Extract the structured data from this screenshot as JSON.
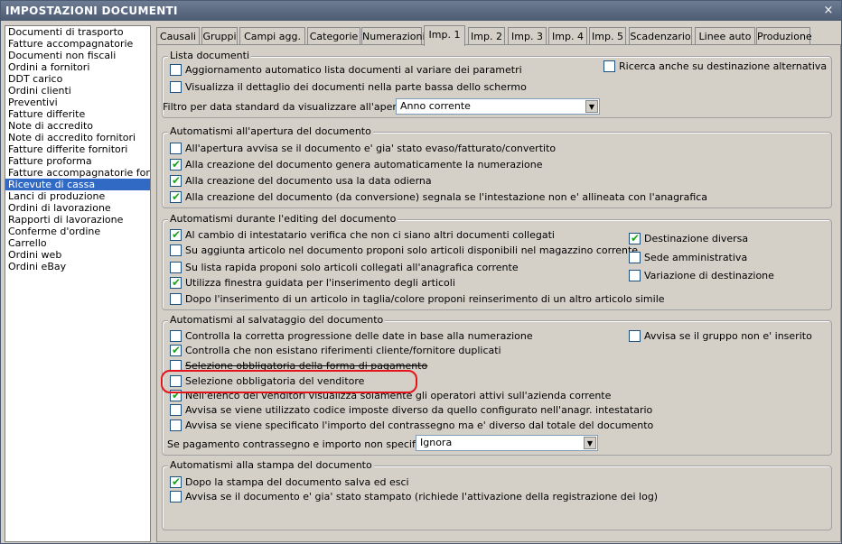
{
  "window": {
    "title": "IMPOSTAZIONI DOCUMENTI",
    "close_symbol": "×"
  },
  "doc_list": [
    "Documenti di trasporto",
    "Fatture accompagnatorie",
    "Documenti non fiscali",
    "Ordini a fornitori",
    "DDT carico",
    "Ordini clienti",
    "Preventivi",
    "Fatture differite",
    "Note di accredito",
    "Note di accredito fornitori",
    "Fatture differite fornitori",
    "Fatture proforma",
    "Fatture accompagnatorie fornito",
    "Ricevute di cassa",
    "Lanci di produzione",
    "Ordini di lavorazione",
    "Rapporti di lavorazione",
    "Conferme d'ordine",
    "Carrello",
    "Ordini web",
    "Ordini eBay"
  ],
  "doc_list_selected": "Ricevute di cassa",
  "tabs": [
    "Causali",
    "Gruppi",
    "Campi agg.",
    "Categorie",
    "Numerazioni",
    "Imp. 1",
    "Imp. 2",
    "Imp. 3",
    "Imp. 4",
    "Imp. 5",
    "Scadenzario",
    "Linee auto",
    "Produzione"
  ],
  "active_tab": "Imp. 1",
  "lista": {
    "label": "Lista documenti",
    "cb1": "Aggiornamento automatico lista documenti al variare dei parametri",
    "cb2": "Visualizza il dettaglio dei documenti nella parte bassa dello schermo",
    "cb3": "Ricerca anche su destinazione alternativa",
    "filtro_label": "Filtro per data standard da visualizzare all'apertura :",
    "filtro_value": "Anno corrente"
  },
  "apertura": {
    "label": "Automatismi all'apertura del documento",
    "cb1": "All'apertura avvisa se il documento e' gia' stato evaso/fatturato/convertito",
    "cb2": "Alla creazione del documento genera automaticamente la numerazione",
    "cb3": "Alla creazione del documento usa la data odierna",
    "cb4": "Alla creazione del documento (da conversione) segnala se l'intestazione non e' allineata con l'anagrafica"
  },
  "editing": {
    "label": "Automatismi durante l'editing del documento",
    "cb1": "Al cambio di intestatario verifica che non ci siano altri documenti collegati",
    "cb2": "Su aggiunta articolo nel documento proponi solo articoli disponibili nel magazzino corrente",
    "cb3": "Su lista rapida proponi solo articoli collegati all'anagrafica corrente",
    "cb4": "Utilizza finestra guidata per l'inserimento degli articoli",
    "cb5": "Dopo l'inserimento di un articolo in taglia/colore proponi reinserimento di un altro articolo simile",
    "cb6": "Destinazione diversa",
    "cb7": "Sede amministrativa",
    "cb8": "Variazione di destinazione"
  },
  "salvataggio": {
    "label": "Automatismi al salvataggio del documento",
    "cb1": "Controlla la corretta progressione delle date in base alla numerazione",
    "cb2": "Controlla che non esistano riferimenti cliente/fornitore duplicati",
    "cb3": "Selezione obbligatoria della forma di pagamento",
    "cb4": "Selezione obbligatoria del venditore",
    "cb5": "Nell'elenco dei venditori visualizza solamente gli operatori attivi sull'azienda corrente",
    "cb6": "Avvisa se viene utilizzato codice imposte diverso da quello configurato nell'anagr. intestatario",
    "cb7": "Avvisa se viene specificato l'importo del contrassegno ma e' diverso dal totale del documento",
    "cb8": "Avvisa se il gruppo non e' inserito",
    "contrassegno_label": "Se pagamento contrassegno e importo non specificato :",
    "contrassegno_value": "Ignora"
  },
  "stampa": {
    "label": "Automatismi alla stampa del documento",
    "cb1": "Dopo la stampa del documento salva ed esci",
    "cb2": "Avvisa se il documento e' gia' stato stampato (richiede l'attivazione della registrazione dei log)"
  },
  "check_mark": "✔",
  "dropdown_arrow": "▼"
}
